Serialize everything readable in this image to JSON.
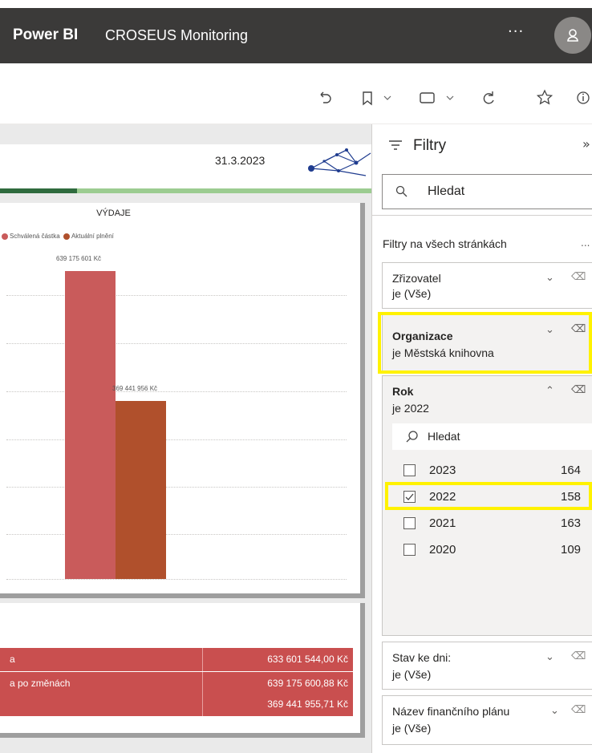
{
  "topbar": {
    "app_name": "Power BI",
    "report_name": "CROSEUS Monitoring",
    "more": "···"
  },
  "report": {
    "date": "31.3.2023",
    "chart": {
      "title": "VÝDAJE",
      "legend": [
        "Schválená částka",
        "Aktuální plnění"
      ],
      "colors": {
        "approved": "#c95b5b",
        "actual": "#b0502c"
      }
    },
    "chart_data": {
      "type": "bar",
      "title": "VÝDAJE",
      "categories": [
        ""
      ],
      "series": [
        {
          "name": "Schválená částka",
          "values": [
            639175601
          ]
        },
        {
          "name": "Aktuální plnění",
          "values": [
            369441956
          ]
        }
      ],
      "data_labels": [
        "639 175 601 Kč",
        "369 441 956 Kč"
      ],
      "ylim": [
        0,
        800000000
      ]
    },
    "table": {
      "rows": [
        {
          "label": "a",
          "value": "633 601 544,00 Kč"
        },
        {
          "label": "a po změnách",
          "value": "639 175 600,88 Kč"
        },
        {
          "label": "",
          "value": "369 441 955,71 Kč"
        }
      ]
    }
  },
  "filters": {
    "title": "Filtry",
    "search_placeholder": "Hledat",
    "section_label": "Filtry na všech stránkách",
    "section_more": "...",
    "cards": [
      {
        "name": "Zřizovatel",
        "value": "je (Vše)"
      },
      {
        "name": "Organizace",
        "value": "je Městská knihovna"
      },
      {
        "name": "Rok",
        "value": "je 2022"
      },
      {
        "name": "Stav ke dni:",
        "value": "je (Vše)"
      },
      {
        "name": "Název finančního plánu",
        "value": "je (Vše)"
      }
    ],
    "rok": {
      "search_placeholder": "Hledat",
      "options": [
        {
          "year": "2023",
          "count": "164",
          "checked": false
        },
        {
          "year": "2022",
          "count": "158",
          "checked": true
        },
        {
          "year": "2021",
          "count": "163",
          "checked": false
        },
        {
          "year": "2020",
          "count": "109",
          "checked": false
        }
      ]
    }
  }
}
